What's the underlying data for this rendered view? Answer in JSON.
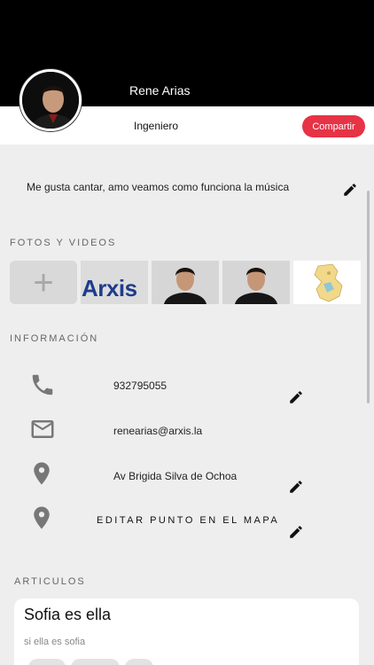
{
  "profile": {
    "name": "Rene Arias",
    "role": "Ingeniero",
    "share_label": "Compartir"
  },
  "bio": {
    "text": "Me gusta cantar, amo veamos como funciona la música"
  },
  "sections": {
    "media_title": "FOTOS Y VIDEOS",
    "info_title": "INFORMACIÓN",
    "articles_title": "ARTICULOS"
  },
  "media": {
    "add_symbol": "+",
    "logo_text": "Arxis",
    "tiles": [
      "add",
      "arxis-logo",
      "portrait-photo",
      "portrait-photo",
      "map-image"
    ]
  },
  "info": {
    "phone": "932795055",
    "email": "renearias@arxis.la",
    "address": "Av Brigida Silva de Ochoa",
    "map_label": "EDITAR PUNTO EN EL MAPA"
  },
  "article": {
    "title": "Sofia es ella",
    "subtitle": "si ella es sofia"
  },
  "colors": {
    "accent": "#e63346",
    "header": "#000000",
    "background": "#eeeeee",
    "icon": "#777777"
  }
}
